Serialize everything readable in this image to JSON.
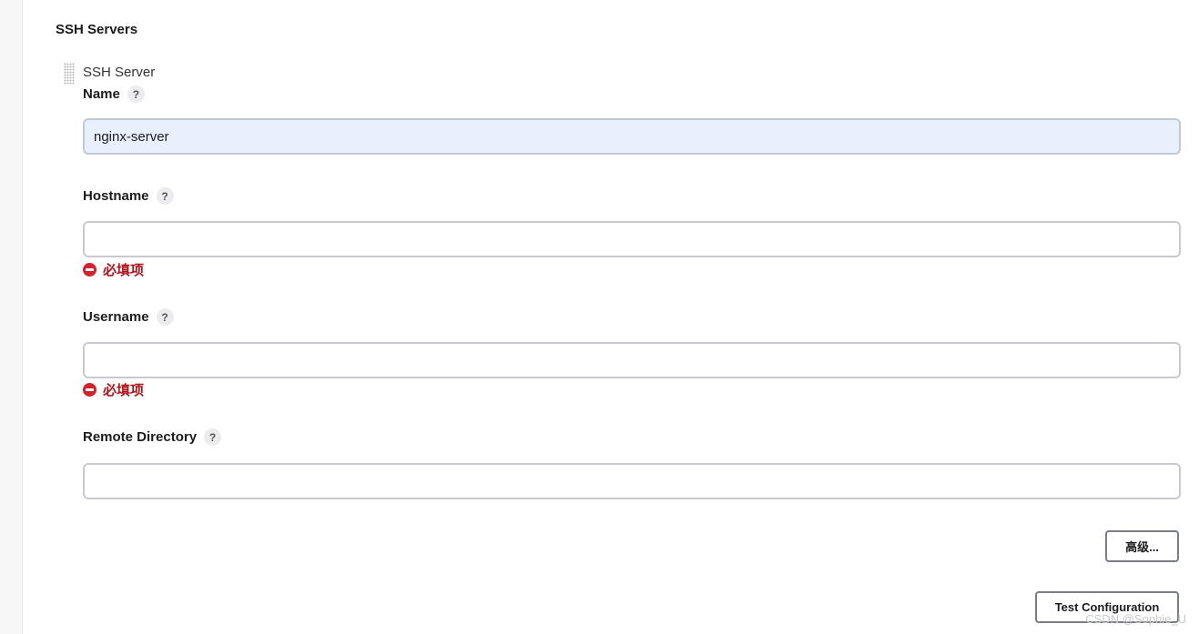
{
  "section": {
    "title": "SSH Servers"
  },
  "server": {
    "title": "SSH Server",
    "fields": {
      "name": {
        "label": "Name",
        "help": "?",
        "value": "nginx-server"
      },
      "hostname": {
        "label": "Hostname",
        "help": "?",
        "value": "",
        "error": "必填项"
      },
      "username": {
        "label": "Username",
        "help": "?",
        "value": "",
        "error": "必填项"
      },
      "remote_directory": {
        "label": "Remote Directory",
        "help": "?",
        "value": ""
      }
    },
    "advanced_button": "高级...",
    "test_button": "Test Configuration"
  },
  "watermark": "CSDN @Sophie_U",
  "colors": {
    "error": "#b0151c",
    "error_icon": "#d6202a",
    "autofill_bg": "#e8effd",
    "input_border": "#c9cacf",
    "button_border": "#7b7d85"
  },
  "icons": [
    "drag-handle-icon",
    "help-icon",
    "error-icon"
  ]
}
